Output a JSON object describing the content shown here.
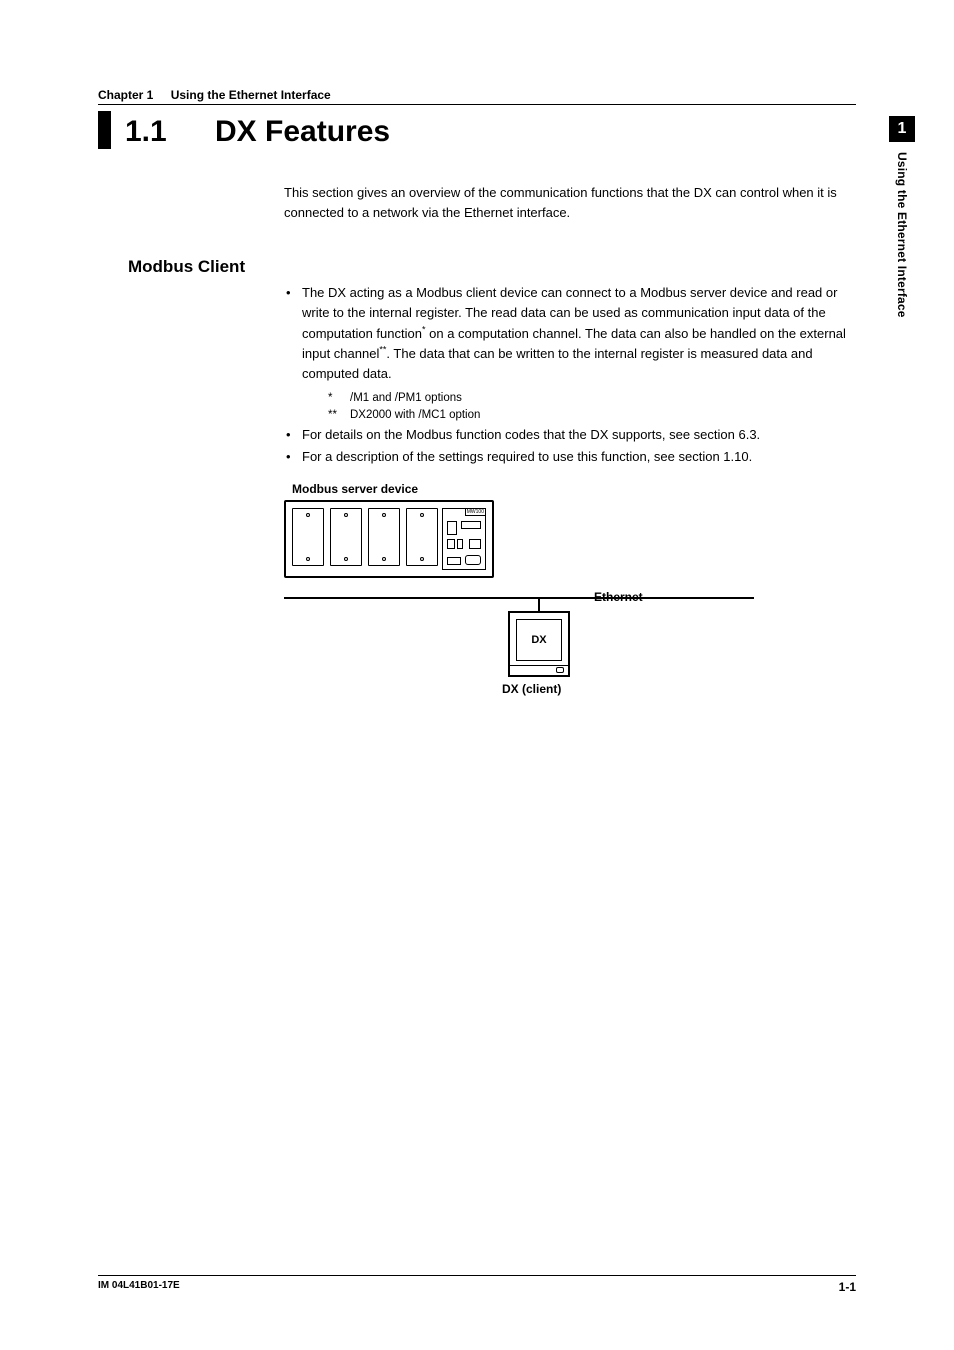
{
  "chapter": {
    "label": "Chapter 1",
    "title": "Using the Ethernet Interface"
  },
  "section": {
    "number": "1.1",
    "title": "DX Features"
  },
  "intro": "This section gives an overview of the communication functions that the DX can control when it is connected to a network via the Ethernet interface.",
  "subsection": {
    "title": "Modbus Client"
  },
  "bullets": {
    "b1_pre": "The DX acting as a Modbus client device can connect to a Modbus server device and read or write to the internal register.  The read data can be used as communication input data of the computation function",
    "b1_sup1": "*",
    "b1_mid": " on a computation channel.  The data can also be handled on the external input channel",
    "b1_sup2": "**",
    "b1_post": ".  The data that can be written to the internal register is measured data and computed data.",
    "b2": "For details on the Modbus function codes that the DX supports, see section 6.3.",
    "b3": "For a description of the settings required to use this function, see section 1.10."
  },
  "footnotes": {
    "f1_mark": "*",
    "f1_text": "/M1 and /PM1 options",
    "f2_mark": "**",
    "f2_text": "DX2000 with /MC1 option"
  },
  "diagram": {
    "server_title": "Modbus server device",
    "server_model": "MW100",
    "ethernet": "Ethernet",
    "dx": "DX",
    "client": "DX (client)"
  },
  "sidebar": {
    "chapter_num": "1",
    "chapter_title": "Using the Ethernet Interface"
  },
  "footer": {
    "doc_id": "IM 04L41B01-17E",
    "page": "1-1"
  }
}
